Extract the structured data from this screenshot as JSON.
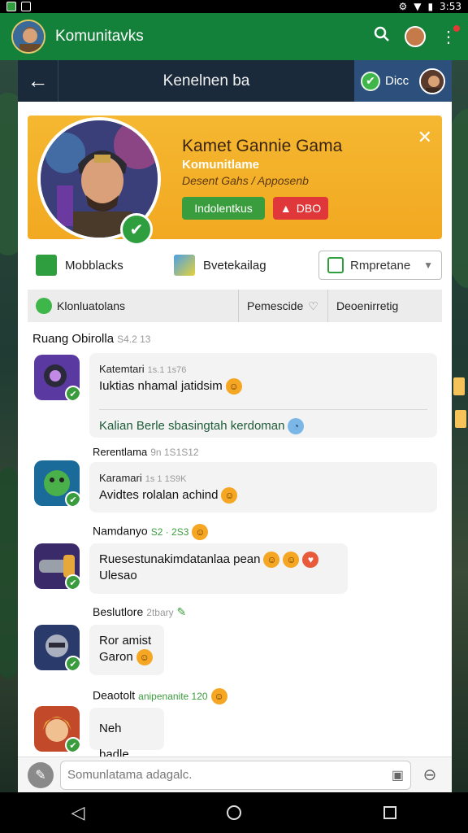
{
  "statusbar": {
    "time": "3:53"
  },
  "appbar": {
    "title": "Komunitavks",
    "colors": {
      "bg": "#14813a"
    }
  },
  "card": {
    "title": "Kenelnen ba",
    "status_label": "Dicc"
  },
  "profile": {
    "title": "Kamet Gannie Gama",
    "subtitle": "Komunitlame",
    "description": "Desent Gahs / Apposenb",
    "green_button": "Indolentkus",
    "red_button": "DBO"
  },
  "options": {
    "item1": "Mobblacks",
    "item2": "Bvetekailag",
    "select_value": "Rmpretane"
  },
  "tabs": [
    {
      "label": "Klonluatolans"
    },
    {
      "label": "Pemescide"
    },
    {
      "label": "Deoenirretig"
    }
  ],
  "chat": {
    "heading": "Ruang Obirolla",
    "heading_ts": "S4.2 13",
    "messages": [
      {
        "name": "Katemtari",
        "ts": "1s.1 1s76",
        "text": "Iuktias nhamal jatidsim",
        "reply": "Kalian Berle sbasingtah kerdoman"
      },
      {
        "header": "Rerentlama",
        "header_ts": "9n 1S1S12",
        "name": "Karamari",
        "ts": "1s 1 1S9K",
        "text": "Avidtes rolalan achind"
      },
      {
        "header": "Namdanyo",
        "header_ts": "S2 · 2S3",
        "text": "Ruesestunakimdatanlaa pean",
        "text2": "Ulesao"
      },
      {
        "header": "Beslutlore",
        "header_ts": "2tbary",
        "text": "Ror amist",
        "text2": "Garon"
      },
      {
        "header": "Deaotolt",
        "header_ts": "anipenanite 120",
        "text": "Neh badle"
      }
    ]
  },
  "composer": {
    "placeholder": "Somunlatama adagalc."
  }
}
